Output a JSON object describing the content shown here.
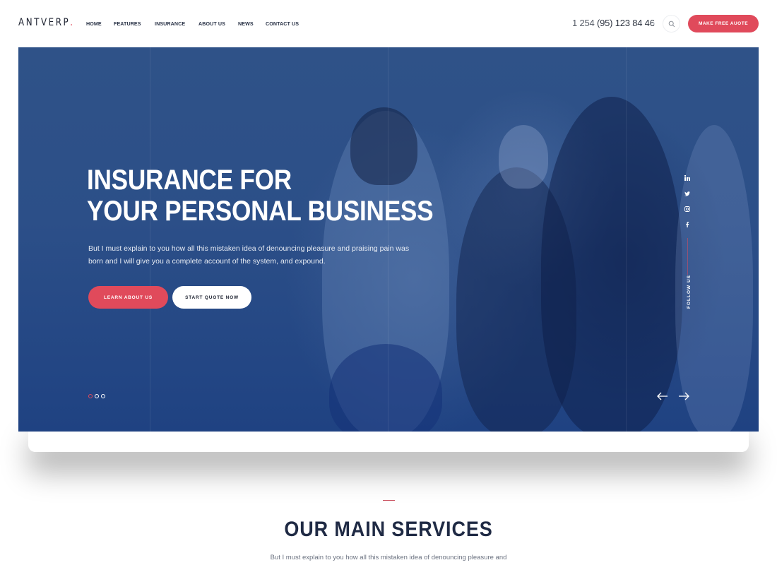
{
  "header": {
    "logo": "ANTVERP",
    "logo_dot": ".",
    "nav": [
      {
        "label": "HOME"
      },
      {
        "label": "FEATURES"
      },
      {
        "label": "INSURANCE"
      },
      {
        "label": "ABOUT US"
      },
      {
        "label": "NEWS"
      },
      {
        "label": "CONTACT US"
      }
    ],
    "phone_prefix": "1 254",
    "phone_main": "(95) 123 84 46",
    "search_icon": "search-icon",
    "quote_button": "MAKE FREE AUOTE"
  },
  "hero": {
    "title_line1": "INSURANCE FOR",
    "title_line2": "YOUR PERSONAL BUSINESS",
    "text": "But I must explain to you how all this mistaken idea of denouncing pleasure and praising pain was born and I will give you a complete account of the system, and expound.",
    "learn_button": "LEARN ABOUT US",
    "start_button": "START QUOTE NOW",
    "slides": {
      "count": 3,
      "active": 1
    },
    "prev_icon": "arrow-left-icon",
    "next_icon": "arrow-right-icon",
    "social": [
      "linkedin-icon",
      "twitter-icon",
      "instagram-icon",
      "facebook-icon"
    ],
    "follow_label": "FOLLOW US"
  },
  "services": {
    "title": "OUR MAIN SERVICES",
    "text": "But I must explain to you how all this mistaken idea of denouncing pleasure and"
  },
  "colors": {
    "accent": "#e04a5b",
    "hero_overlay": "#2c4f88",
    "heading": "#1f2a44"
  }
}
